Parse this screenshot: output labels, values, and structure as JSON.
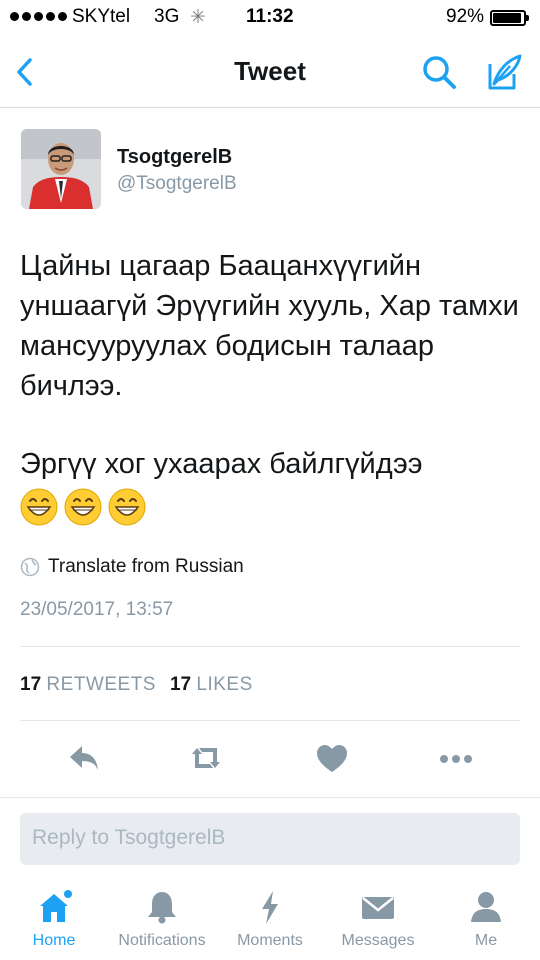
{
  "status_bar": {
    "carrier": "SKYtel",
    "network": "3G",
    "time": "11:32",
    "battery_percent": "92%",
    "battery_level": 0.92
  },
  "nav": {
    "title": "Tweet",
    "icons": [
      "chevron-left-icon",
      "search-icon",
      "compose-icon"
    ]
  },
  "tweet": {
    "display_name": "TsogtgerelB",
    "handle": "@TsogtgerelB",
    "text": "Цайны цагаар Бааца­нхүүгийн уншаагүй Эрүүгийн хууль, Хар тамхи мансууруулах бодисын талаар бичлээ.",
    "text2": "Эргүү хог ухаарах байлгүйдээ",
    "emoji": [
      "grinning-face",
      "grinning-face",
      "grinning-face"
    ],
    "translate": "Translate from Russian",
    "timestamp": "23/05/2017, 13:57",
    "retweets_count": "17",
    "retweets_label": "RETWEETS",
    "likes_count": "17",
    "likes_label": "LIKES"
  },
  "actions": [
    "reply-icon",
    "retweet-icon",
    "like-icon",
    "more-icon"
  ],
  "reply": {
    "placeholder": "Reply to TsogtgerelB"
  },
  "tabs": [
    {
      "label": "Home",
      "icon": "home-icon",
      "active": true
    },
    {
      "label": "Notifications",
      "icon": "bell-icon",
      "active": false
    },
    {
      "label": "Moments",
      "icon": "lightning-icon",
      "active": false
    },
    {
      "label": "Messages",
      "icon": "envelope-icon",
      "active": false
    },
    {
      "label": "Me",
      "icon": "person-icon",
      "active": false
    }
  ],
  "colors": {
    "accent": "#1da1f2",
    "muted": "#8899a6",
    "text": "#14171a",
    "action_icon": "#8899a6"
  }
}
